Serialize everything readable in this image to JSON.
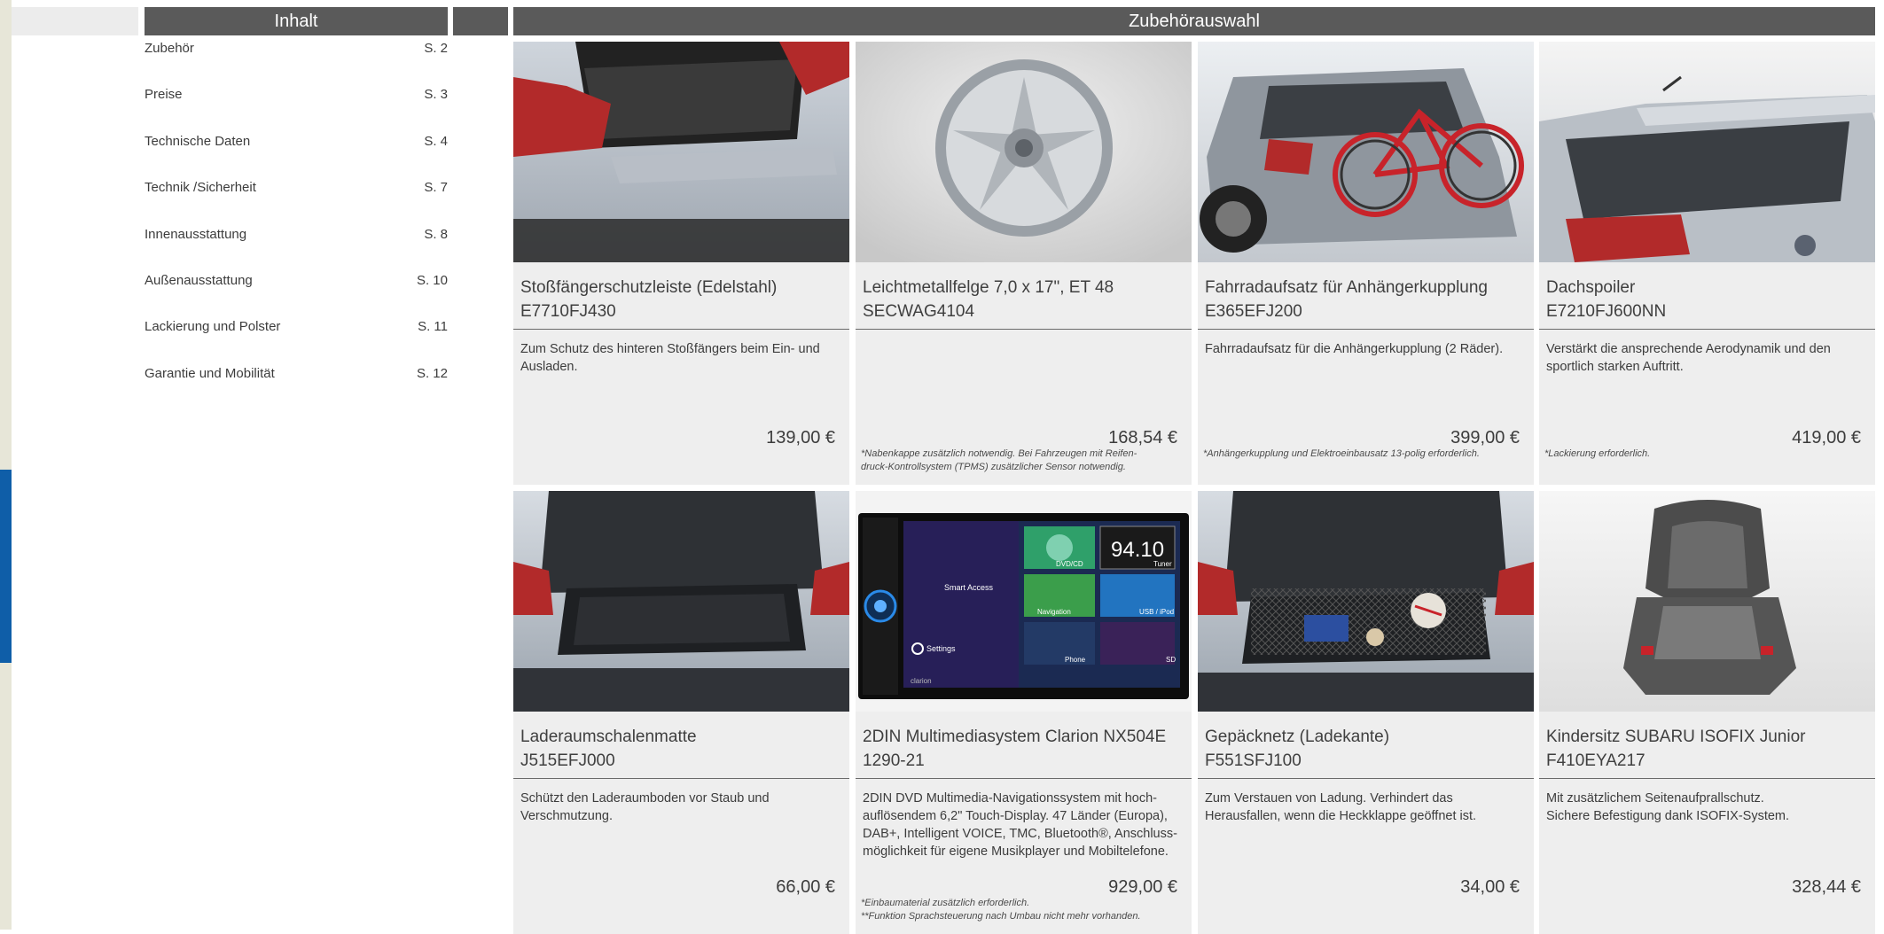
{
  "toc": {
    "header": "Inhalt",
    "items": [
      {
        "label": "Zubehör",
        "page": "S. 2"
      },
      {
        "label": "Preise",
        "page": "S. 3"
      },
      {
        "label": "Technische Daten",
        "page": "S. 4"
      },
      {
        "label": "Technik /Sicherheit",
        "page": "S. 7"
      },
      {
        "label": "Innenausstattung",
        "page": "S. 8"
      },
      {
        "label": "Außenausstattung",
        "page": "S. 10"
      },
      {
        "label": "Lackierung und Polster",
        "page": "S. 11"
      },
      {
        "label": "Garantie und Mobilität",
        "page": "S. 12"
      }
    ]
  },
  "main": {
    "header": "Zubehörauswahl",
    "products": [
      {
        "name": "Stoßfängerschutzleiste (Edelstahl)",
        "code": "E7710FJ430",
        "description": "Zum Schutz des hinteren Stoßfängers beim Ein- und Ausladen.",
        "price": "139,00 €",
        "note": ""
      },
      {
        "name": "Leichtmetallfelge 7,0 x 17\", ET 48",
        "code": "SECWAG4104",
        "description": "",
        "price": "168,54 €",
        "note": "*Nabenkappe zusätzlich notwendig. Bei Fahrzeugen mit Reifen-\ndruck-Kontrollsystem (TPMS) zusätzlicher Sensor notwendig."
      },
      {
        "name": "Fahrradaufsatz für Anhängerkupplung",
        "code": "E365EFJ200",
        "description": "Fahrradaufsatz für die Anhängerkupplung (2 Räder).",
        "price": "399,00 €",
        "note": "*Anhängerkupplung und Elektroeinbausatz 13-polig erforderlich."
      },
      {
        "name": "Dachspoiler",
        "code": "E7210FJ600NN",
        "description": "Verstärkt die ansprechende Aerodynamik und den sportlich starken Auftritt.",
        "price": "419,00 €",
        "note": "*Lackierung erforderlich."
      },
      {
        "name": "Laderaumschalenmatte",
        "code": "J515EFJ000",
        "description": "Schützt den Laderaumboden vor Staub und Verschmutzung.",
        "price": "66,00 €",
        "note": ""
      },
      {
        "name": "2DIN Multimediasystem Clarion NX504E",
        "code": "1290-21",
        "description": "2DIN DVD Multimedia-Navigationssystem mit hoch-\nauflösendem 6,2\" Touch-Display. 47 Länder (Europa),\nDAB+, Intelligent VOICE, TMC, Bluetooth®, Anschluss-\nmöglichkeit für eigene Musikplayer und Mobiltelefone.",
        "price": "929,00 €",
        "note": "*Einbaumaterial zusätzlich erforderlich.\n**Funktion Sprachsteuerung nach Umbau nicht mehr vorhanden."
      },
      {
        "name": "Gepäcknetz (Ladekante)",
        "code": "F551SFJ100",
        "description": "Zum Verstauen von Ladung. Verhindert das\nHerausfallen, wenn die Heckklappe geöffnet ist.",
        "price": "34,00 €",
        "note": ""
      },
      {
        "name": "Kindersitz SUBARU ISOFIX Junior",
        "code": "F410EYA217",
        "description": "Mit zusätzlichem Seitenaufprallschutz.\nSichere Befestigung dank ISOFIX-System.",
        "price": "328,44 €",
        "note": ""
      }
    ]
  },
  "screen": {
    "radio_freq": "94.10",
    "tiles": [
      "DVD/CD",
      "Tuner",
      "Navigation",
      "USB / iPod",
      "Phone",
      "SD"
    ],
    "smart_access": "Smart Access",
    "settings": "Settings",
    "brand": "clarion"
  },
  "colors": {
    "header_bg": "#5a5a5a",
    "card_bg": "#eeeeee",
    "accent_blue": "#0f5ea8",
    "edge": "#e7e6d8"
  }
}
